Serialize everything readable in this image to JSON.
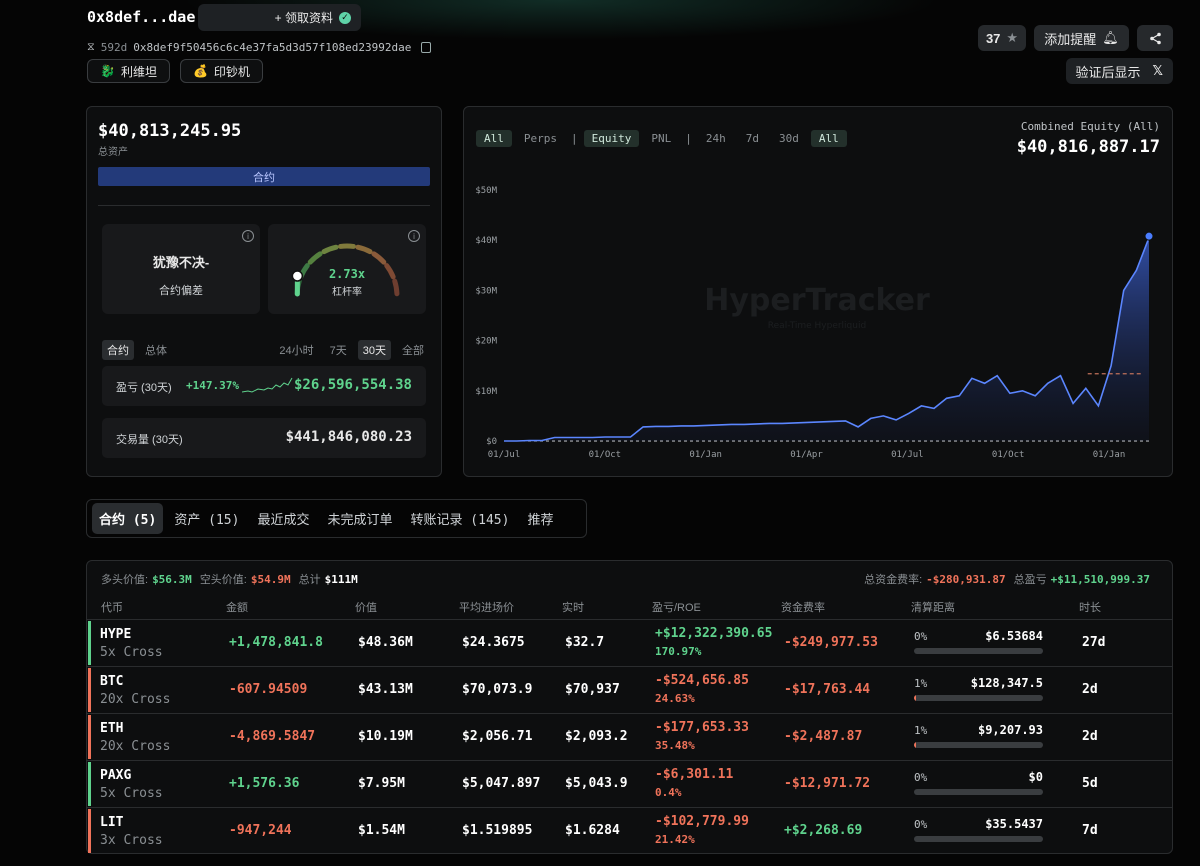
{
  "header": {
    "title": "0x8def...dae",
    "claim_label": "+ 领取资料",
    "age": "592d",
    "address": "0x8def9f50456c6c4e37fa5d3d57f108ed23992dae",
    "tags": [
      {
        "icon": "🐉",
        "label": "利维坦"
      },
      {
        "icon": "💰",
        "label": "印钞机"
      }
    ],
    "star_count": "37",
    "add_alert_label": "添加提醒",
    "verify_show_label": "验证后显示"
  },
  "summary": {
    "equity": "$40,813,245.95",
    "equity_label": "总资产",
    "perp_bar_label": "合约",
    "bias_text": "犹豫不决-",
    "bias_label": "合约偏差",
    "leverage": "2.73x",
    "leverage_label": "杠杆率",
    "gauge_level": 0.0,
    "tabs": [
      "合约",
      "总体"
    ],
    "periods": [
      "24小时",
      "7天",
      "30天",
      "全部"
    ],
    "pnl_label": "盈亏 (30天)",
    "pnl_pct": "+147.37%",
    "pnl_value": "$26,596,554.38",
    "volume_label": "交易量 (30天)",
    "volume_value": "$441,846,080.23"
  },
  "chart_panel": {
    "tabs_left": [
      "All",
      "Perps"
    ],
    "tabs_mid": [
      "Equity",
      "PNL"
    ],
    "tabs_right": [
      "24h",
      "7d",
      "30d",
      "All"
    ],
    "combined_label": "Combined Equity (All)",
    "combined_value": "$40,816,887.17",
    "watermark": "HyperTracker",
    "watermark_sub": "Real-Time Hyperliquid"
  },
  "chart_data": {
    "type": "area",
    "x_ticks": [
      "01/Jul",
      "01/Oct",
      "01/Jan",
      "01/Apr",
      "01/Jul",
      "01/Oct",
      "01/Jan"
    ],
    "y_ticks": [
      "$0",
      "$10M",
      "$20M",
      "$30M",
      "$40M",
      "$50M"
    ],
    "ylim": [
      0,
      50
    ],
    "series": [
      {
        "values": [
          0.0,
          0.0,
          0.1,
          0.1,
          0.7,
          0.7,
          0.7,
          0.7,
          0.8,
          0.8,
          0.8,
          2.8,
          2.9,
          2.9,
          3.0,
          3.0,
          3.1,
          3.2,
          3.3,
          3.3,
          3.4,
          3.5,
          3.5,
          3.6,
          3.7,
          3.8,
          3.9,
          4.0,
          2.8,
          4.5,
          5.0,
          4.2,
          5.5,
          7.0,
          6.5,
          8.5,
          9.0,
          12.5,
          11.5,
          13.0,
          9.5,
          10.0,
          9.0,
          11.5,
          13.0,
          7.5,
          10.5,
          7.0,
          15.0,
          30.0,
          34.0,
          40.5
        ]
      }
    ],
    "reference_level": 13.4,
    "last_value": 40.8
  },
  "bottom_tabs": [
    "合约 (5)",
    "资产 (15)",
    "最近成交",
    "未完成订单",
    "转账记录 (145)",
    "推荐"
  ],
  "positions_summary": {
    "long_label": "多头价值:",
    "long_value": "$56.3M",
    "short_label": "空头价值:",
    "short_value": "$54.9M",
    "total_label": "总计",
    "total_value": "$111M",
    "funding_label": "总资金费率:",
    "funding_value": "-$280,931.87",
    "pnl_label": "总盈亏",
    "pnl_value": "+$11,510,999.37"
  },
  "columns": [
    "代币",
    "金额",
    "价值",
    "平均进场价",
    "实时",
    "盈亏/ROE",
    "资金费率",
    "清算距离",
    "时长"
  ],
  "positions": [
    {
      "coin": "HYPE",
      "lev": "5x Cross",
      "amount": "+1,478,841.8",
      "value": "$48.36M",
      "entry": "$24.3675",
      "mark": "$32.7",
      "pnl": "+$12,322,390.65",
      "roe": "170.97%",
      "funding": "-$249,977.53",
      "liq_pct": "0%",
      "liq_price": "$6.53684",
      "liq_fill": 0.0,
      "duration": "27d",
      "side": "long"
    },
    {
      "coin": "BTC",
      "lev": "20x Cross",
      "amount": "-607.94509",
      "value": "$43.13M",
      "entry": "$70,073.9",
      "mark": "$70,937",
      "pnl": "-$524,656.85",
      "roe": "24.63%",
      "funding": "-$17,763.44",
      "liq_pct": "1%",
      "liq_price": "$128,347.5",
      "liq_fill": 0.01,
      "duration": "2d",
      "side": "short"
    },
    {
      "coin": "ETH",
      "lev": "20x Cross",
      "amount": "-4,869.5847",
      "value": "$10.19M",
      "entry": "$2,056.71",
      "mark": "$2,093.2",
      "pnl": "-$177,653.33",
      "roe": "35.48%",
      "funding": "-$2,487.87",
      "liq_pct": "1%",
      "liq_price": "$9,207.93",
      "liq_fill": 0.01,
      "duration": "2d",
      "side": "short"
    },
    {
      "coin": "PAXG",
      "lev": "5x Cross",
      "amount": "+1,576.36",
      "value": "$7.95M",
      "entry": "$5,047.897",
      "mark": "$5,043.9",
      "pnl": "-$6,301.11",
      "roe": "0.4%",
      "funding": "-$12,971.72",
      "liq_pct": "0%",
      "liq_price": "$0",
      "liq_fill": 0.0,
      "duration": "5d",
      "side": "long"
    },
    {
      "coin": "LIT",
      "lev": "3x Cross",
      "amount": "-947,244",
      "value": "$1.54M",
      "entry": "$1.519895",
      "mark": "$1.6284",
      "pnl": "-$102,779.99",
      "roe": "21.42%",
      "funding": "+$2,268.69",
      "liq_pct": "0%",
      "liq_price": "$35.5437",
      "liq_fill": 0.0,
      "duration": "7d",
      "side": "short"
    }
  ],
  "colors": {
    "green": "#5fd38d",
    "red": "#f0735a",
    "accent_blue": "#4a7dff"
  }
}
